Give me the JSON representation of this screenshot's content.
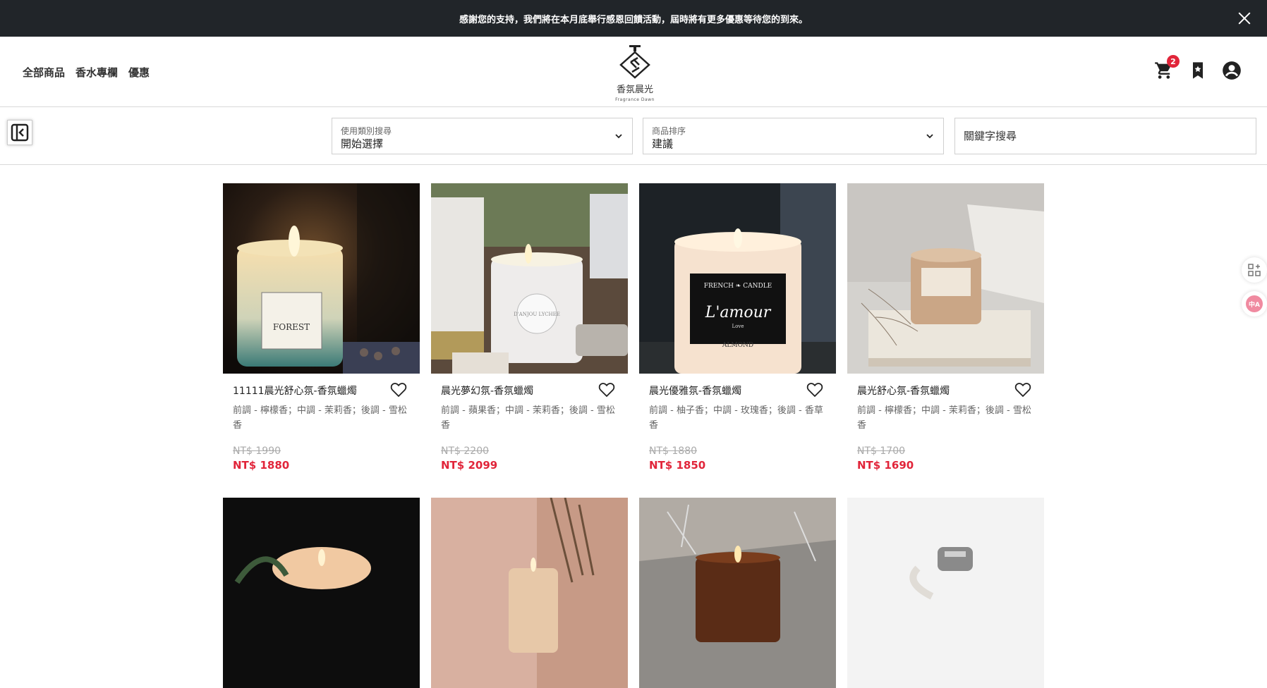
{
  "announcement": {
    "text": "感謝您的支持，我們將在本月底舉行感恩回饋活動，屆時將有更多優惠等待您的到來。"
  },
  "nav": {
    "items": [
      "全部商品",
      "香水專欄",
      "優惠"
    ]
  },
  "logo": {
    "name": "香氛晨光",
    "name_en": "Fragrance Dawn"
  },
  "header": {
    "cart_count": "2",
    "icons": [
      "cart-icon",
      "bookmark-icon",
      "account-icon"
    ]
  },
  "filters": {
    "category": {
      "label": "使用類別搜尋",
      "value": "開始選擇"
    },
    "sort": {
      "label": "商品排序",
      "value": "建議"
    },
    "search": {
      "placeholder": "關鍵字搜尋",
      "value": ""
    }
  },
  "products": [
    {
      "name": "11111晨光舒心氛-香氛蠟燭",
      "notes": "前調 - 檸檬香；中調 - 茉莉香；後調 - 雪松香",
      "old_price": "NT$ 1990",
      "price": "NT$ 1880",
      "label": "FOREST"
    },
    {
      "name": "晨光夢幻氛-香氛蠟燭",
      "notes": "前調 - 蘋果香；中調 - 茉莉香；後調 - 雪松香",
      "old_price": "NT$ 2200",
      "price": "NT$ 2099",
      "label": "D'ANJOU LYCHEE"
    },
    {
      "name": "晨光優雅氛-香氛蠟燭",
      "notes": "前調 - 柚子香；中調 - 玫瑰香；後調 - 香草香",
      "old_price": "NT$ 1880",
      "price": "NT$ 1850",
      "label": "L'amour"
    },
    {
      "name": "晨光舒心氛-香氛蠟燭",
      "notes": "前調 - 檸檬香；中調 - 茉莉香；後調 - 雪松香",
      "old_price": "NT$ 1700",
      "price": "NT$ 1690",
      "label": ""
    }
  ],
  "colors": {
    "announce_bg": "#212529",
    "price_red": "#e1253a",
    "badge_red": "#e1253a"
  }
}
